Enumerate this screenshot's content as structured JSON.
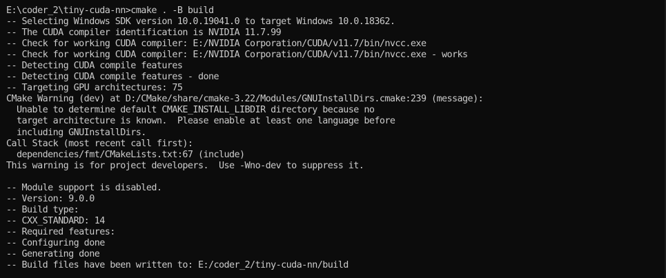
{
  "console": {
    "lines": [
      "E:\\coder_2\\tiny-cuda-nn>cmake . -B build",
      "-- Selecting Windows SDK version 10.0.19041.0 to target Windows 10.0.18362.",
      "-- The CUDA compiler identification is NVIDIA 11.7.99",
      "-- Check for working CUDA compiler: E:/NVIDIA Corporation/CUDA/v11.7/bin/nvcc.exe",
      "-- Check for working CUDA compiler: E:/NVIDIA Corporation/CUDA/v11.7/bin/nvcc.exe - works",
      "-- Detecting CUDA compile features",
      "-- Detecting CUDA compile features - done",
      "-- Targeting GPU architectures: 75",
      "CMake Warning (dev) at D:/CMake/share/cmake-3.22/Modules/GNUInstallDirs.cmake:239 (message):",
      "  Unable to determine default CMAKE_INSTALL_LIBDIR directory because no",
      "  target architecture is known.  Please enable at least one language before",
      "  including GNUInstallDirs.",
      "Call Stack (most recent call first):",
      "  dependencies/fmt/CMakeLists.txt:67 (include)",
      "This warning is for project developers.  Use -Wno-dev to suppress it.",
      "",
      "-- Module support is disabled.",
      "-- Version: 9.0.0",
      "-- Build type:",
      "-- CXX_STANDARD: 14",
      "-- Required features:",
      "-- Configuring done",
      "-- Generating done",
      "-- Build files have been written to: E:/coder_2/tiny-cuda-nn/build"
    ]
  }
}
